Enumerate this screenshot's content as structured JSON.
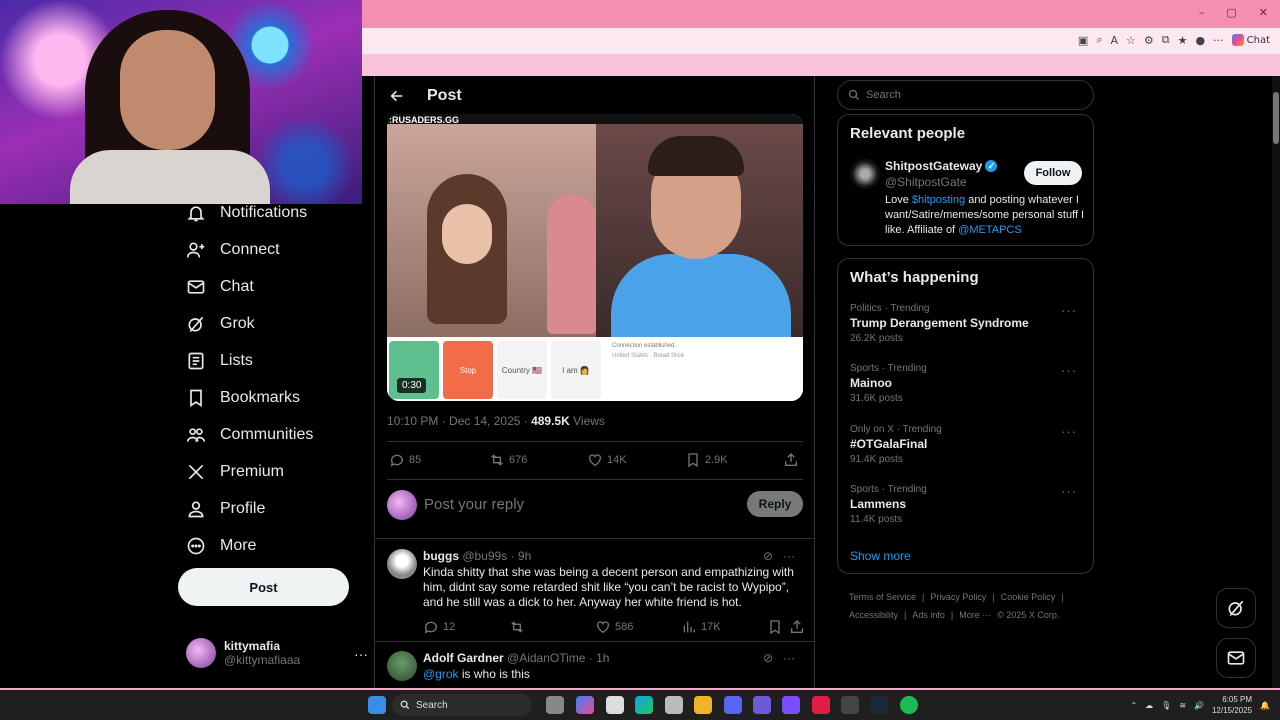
{
  "browser": {
    "chat_label": "Chat",
    "window_controls": [
      "–",
      "▢",
      "✕"
    ]
  },
  "nav": {
    "items": [
      {
        "label": "Notifications",
        "icon": "bell-icon"
      },
      {
        "label": "Connect",
        "icon": "person-plus-icon"
      },
      {
        "label": "Chat",
        "icon": "mail-icon"
      },
      {
        "label": "Grok",
        "icon": "grok-icon"
      },
      {
        "label": "Lists",
        "icon": "list-icon"
      },
      {
        "label": "Bookmarks",
        "icon": "bookmark-icon"
      },
      {
        "label": "Communities",
        "icon": "communities-icon"
      },
      {
        "label": "Premium",
        "icon": "x-logo-icon"
      },
      {
        "label": "Profile",
        "icon": "person-icon"
      },
      {
        "label": "More",
        "icon": "more-circle-icon"
      }
    ],
    "post_label": "Post",
    "account": {
      "name": "kittymafia",
      "handle": "@kittymafiaaa",
      "more": "···"
    }
  },
  "post": {
    "header_title": "Post",
    "media": {
      "banner_text": ":RUSADERS.GG",
      "duration": "0:30",
      "tiles": [
        "",
        "Stop",
        "Country 🇺🇸",
        "I am 👩"
      ],
      "chat_text": "Connection established.",
      "location_text": "United States · Bread Slice"
    },
    "timestamp": "10:10 PM · Dec 14, 2025 · ",
    "views_number": "489.5K",
    "views_label": "Views",
    "stats": {
      "replies": "85",
      "reposts": "676",
      "likes": "14K",
      "bookmarks": "2.9K"
    },
    "reply_placeholder": "Post your reply",
    "reply_button": "Reply"
  },
  "comments": [
    {
      "name": "buggs",
      "handle": "@bu99s",
      "time": "· 9h",
      "text": "Kinda shitty that she was being a decent person and empathizing with him, didnt say some retarded shit like “you can’t be racist to Wypipo”, and he still was a dick to her. Anyway her white friend is hot.",
      "replies": "12",
      "likes": "586",
      "views": "17K"
    },
    {
      "name": "Adolf Gardner",
      "handle": "@AidanOTime",
      "time": "· 1h",
      "mention": "@grok",
      "text": " is who is this"
    }
  ],
  "sidebar": {
    "search_placeholder": "Search",
    "relevant_title": "Relevant people",
    "person": {
      "name": "ShitpostGateway",
      "handle": "@ShitpostGate",
      "follow": "Follow",
      "bio_pre": "Love ",
      "bio_link": "$hitposting",
      "bio_mid": " and posting whatever I want/Satire/memes/some personal stuff I like. Affiliate of ",
      "bio_link2": "@METAPCS"
    },
    "happening_title": "What’s happening",
    "trends": [
      {
        "category": "Politics · Trending",
        "name": "Trump Derangement Syndrome",
        "count": "26.2K posts"
      },
      {
        "category": "Sports · Trending",
        "name": "Mainoo",
        "count": "31.6K posts"
      },
      {
        "category": "Only on X · Trending",
        "name": "#OTGalaFinal",
        "count": "91.4K posts"
      },
      {
        "category": "Sports · Trending",
        "name": "Lammens",
        "count": "11.4K posts"
      }
    ],
    "show_more": "Show more",
    "footer": [
      "Terms of Service",
      "|",
      "Privacy Policy",
      "|",
      "Cookie Policy",
      "|",
      "Accessibility",
      "|",
      "Ads info",
      "|",
      "More ···",
      "© 2025 X Corp."
    ]
  },
  "taskbar": {
    "search": "Search",
    "time": "6:05 PM",
    "date": "12/15/2025"
  },
  "colors": {
    "accent": "#1d9bf0",
    "background": "#000000",
    "browser_pink": "#f48fb1"
  }
}
